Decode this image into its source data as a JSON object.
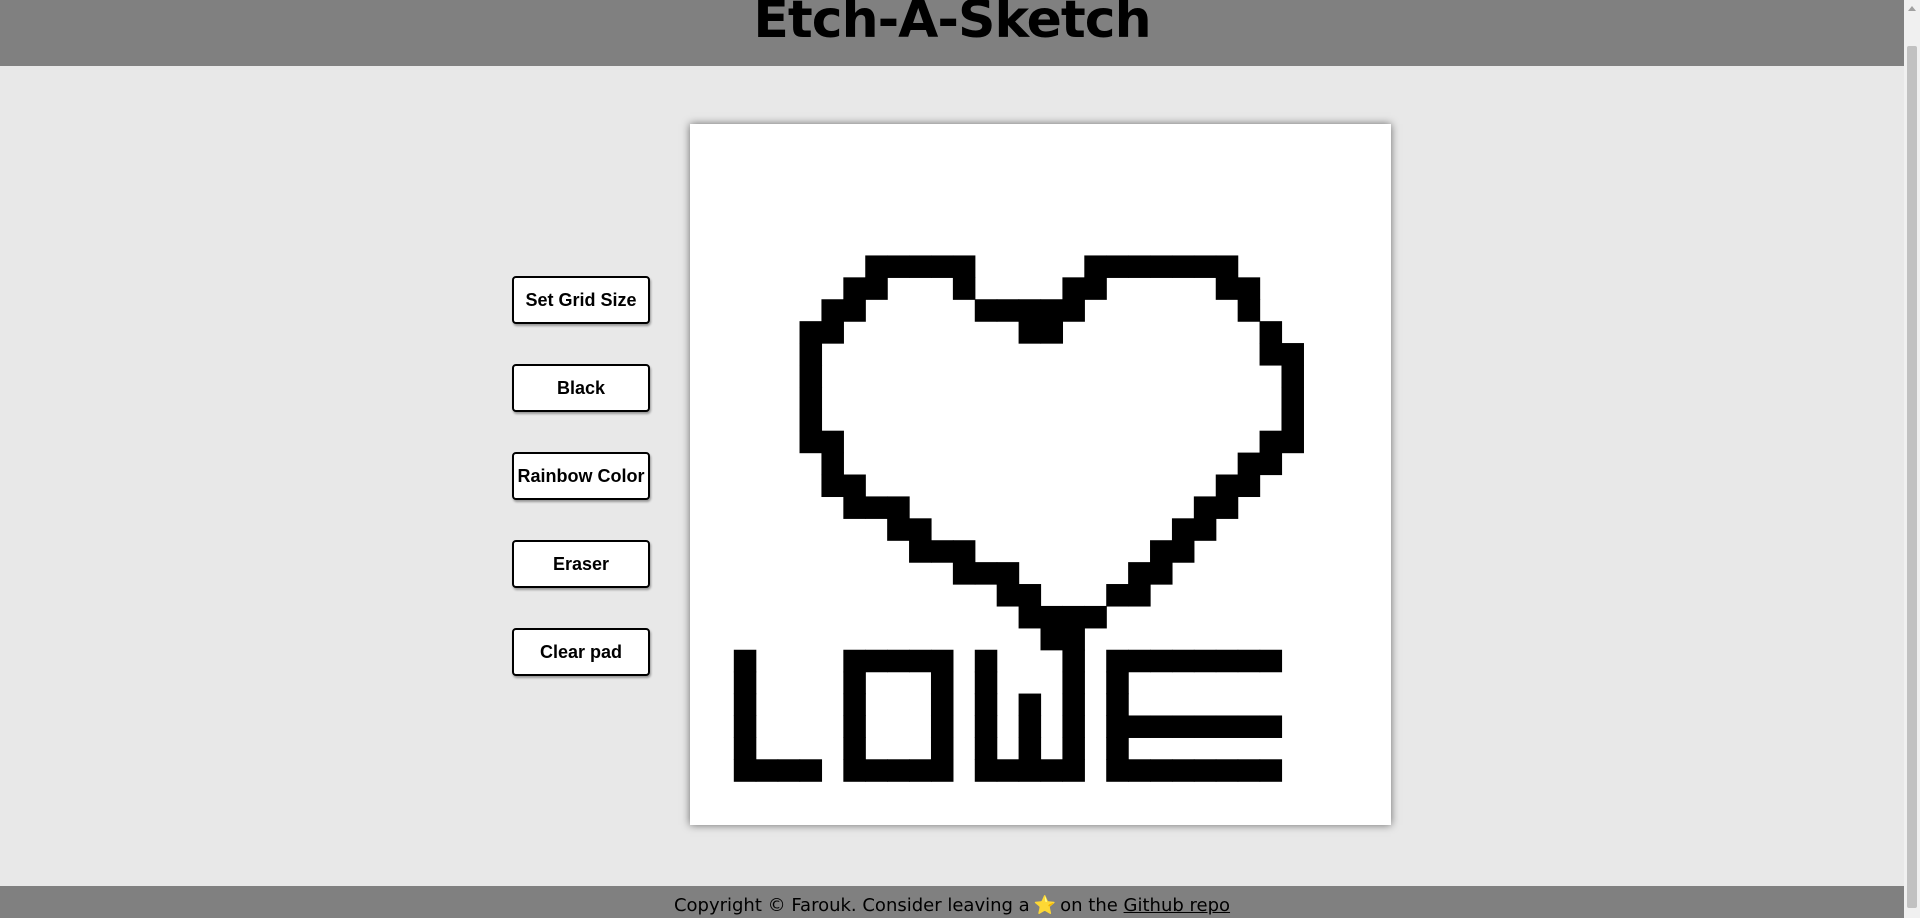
{
  "header": {
    "title": "Etch-A-Sketch"
  },
  "controls": {
    "set_grid_size": "Set Grid Size",
    "black": "Black",
    "rainbow_color": "Rainbow Color",
    "eraser": "Eraser",
    "clear_pad": "Clear pad"
  },
  "pad": {
    "grid_size": 32,
    "ink_color": "#000000",
    "paper_color": "#ffffff",
    "filled_rows": [
      [
        8,
        9,
        10,
        11,
        12,
        18,
        19,
        20,
        21,
        22,
        23,
        24
      ],
      [
        7,
        8,
        12,
        17,
        18,
        24,
        25
      ],
      [
        6,
        7,
        13,
        14,
        15,
        16,
        17,
        25
      ],
      [
        5,
        6,
        15,
        16,
        26
      ],
      [
        5,
        26,
        27
      ],
      [
        5,
        27
      ],
      [
        5,
        27
      ],
      [
        5,
        27
      ],
      [
        5,
        6,
        26,
        27
      ],
      [
        6,
        25,
        26
      ],
      [
        6,
        7,
        24,
        25
      ],
      [
        7,
        8,
        9,
        23,
        24
      ],
      [
        9,
        10,
        22,
        23
      ],
      [
        10,
        11,
        12,
        21,
        22
      ],
      [
        12,
        13,
        14,
        20,
        21
      ],
      [
        14,
        15,
        19,
        20
      ],
      [
        15,
        16,
        17,
        18
      ],
      [
        16,
        17
      ],
      [
        2,
        7,
        8,
        9,
        10,
        11,
        13,
        17,
        19,
        20,
        21,
        22,
        23,
        24,
        25,
        26
      ],
      [
        2,
        7,
        11,
        13,
        17,
        19
      ],
      [
        2,
        7,
        11,
        13,
        15,
        17,
        19
      ],
      [
        2,
        7,
        11,
        13,
        15,
        17,
        19,
        20,
        21,
        22,
        23,
        24,
        25,
        26
      ],
      [
        2,
        7,
        11,
        13,
        15,
        17,
        19
      ],
      [
        2,
        3,
        4,
        5,
        7,
        8,
        9,
        10,
        11,
        13,
        14,
        15,
        16,
        17,
        19,
        20,
        21,
        22,
        23,
        24,
        25,
        26
      ]
    ],
    "first_filled_row": 6
  },
  "footer": {
    "text_before": "Copyright © Farouk. Consider leaving a",
    "star_icon": "⭐",
    "text_after": "on the",
    "link_text": "Github repo"
  }
}
